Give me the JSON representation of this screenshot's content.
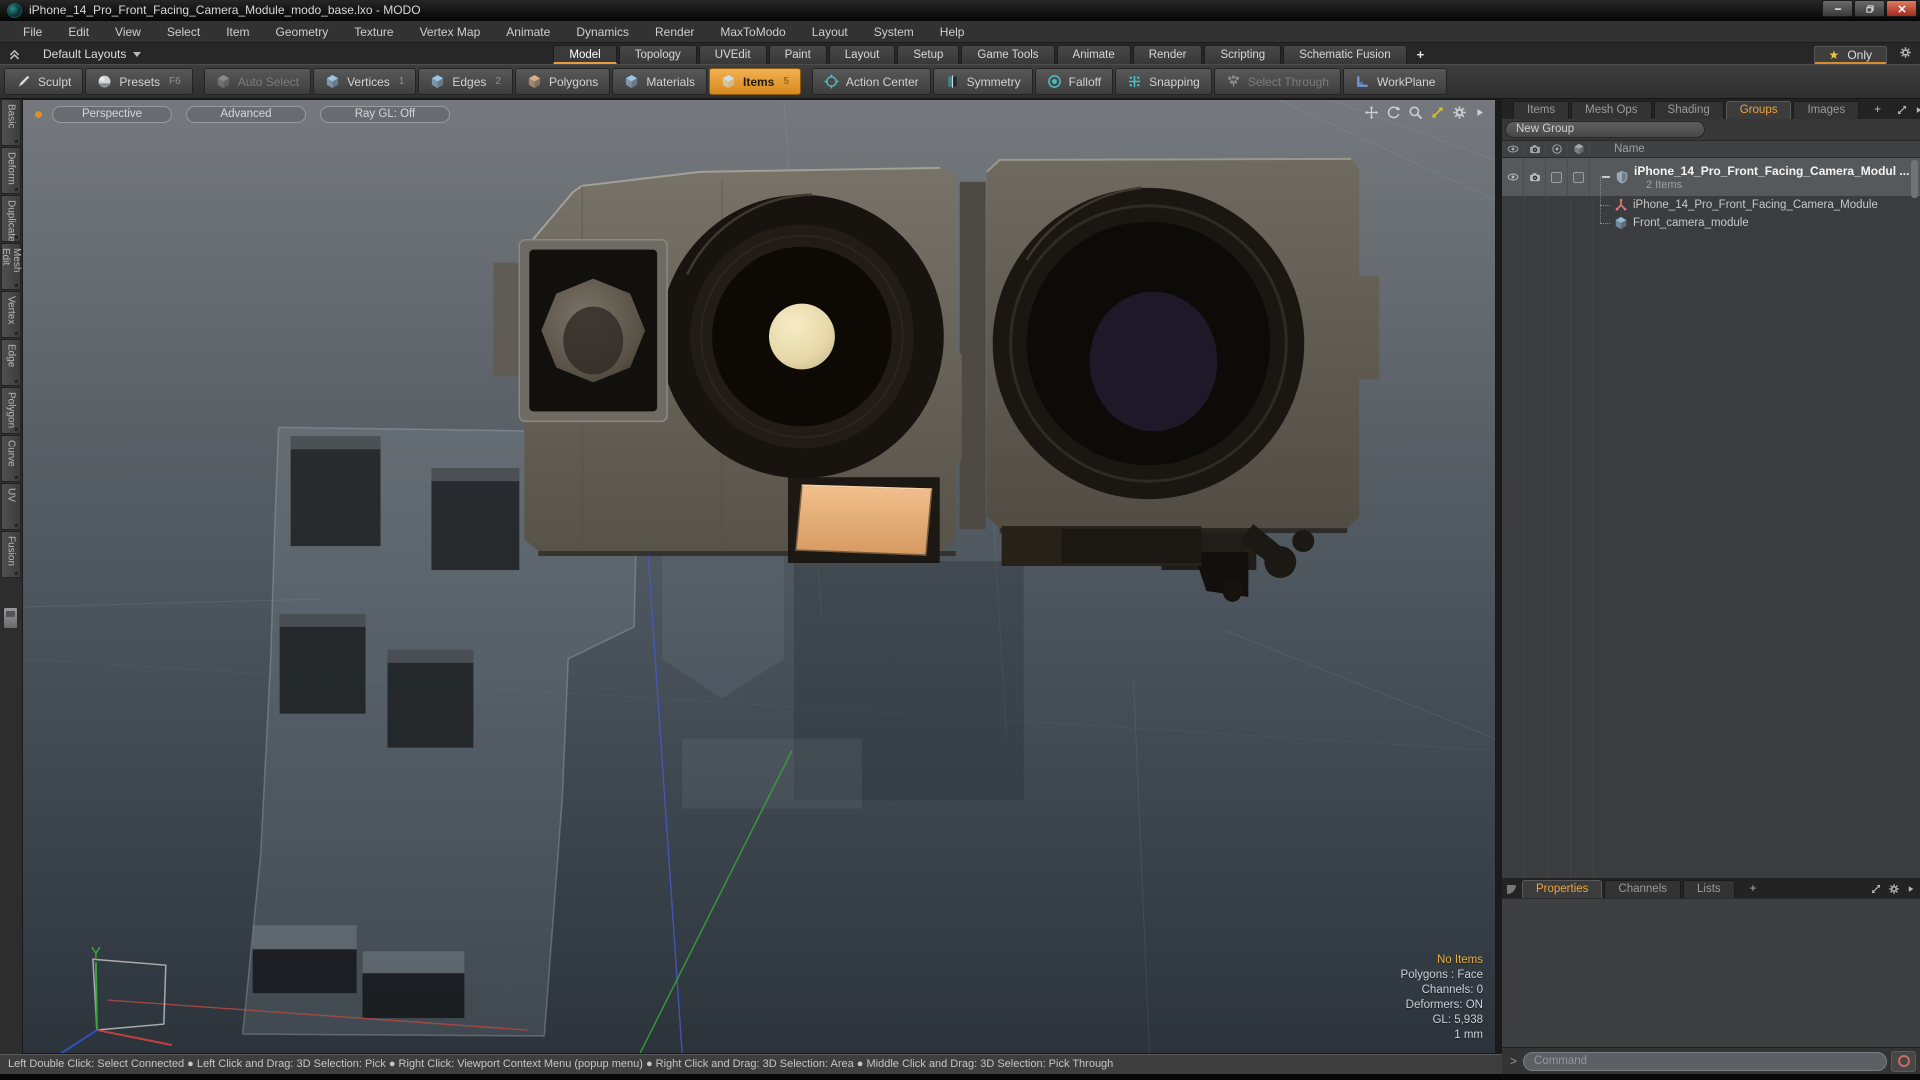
{
  "window": {
    "title": "iPhone_14_Pro_Front_Facing_Camera_Module_modo_base.lxo - MODO"
  },
  "menu": {
    "items": [
      "File",
      "Edit",
      "View",
      "Select",
      "Item",
      "Geometry",
      "Texture",
      "Vertex Map",
      "Animate",
      "Dynamics",
      "Render",
      "MaxToModo",
      "Layout",
      "System",
      "Help"
    ]
  },
  "layout_bar": {
    "layouts_label": "Default Layouts",
    "tabs": [
      "Model",
      "Topology",
      "UVEdit",
      "Paint",
      "Layout",
      "Setup",
      "Game Tools",
      "Animate",
      "Render",
      "Scripting",
      "Schematic Fusion"
    ],
    "add_tab": "+",
    "star": "★",
    "only_label": "Only"
  },
  "toolbar": {
    "sculpt": "Sculpt",
    "presets": "Presets",
    "presets_shortcut": "F6",
    "auto_select": "Auto Select",
    "vertices": "Vertices",
    "vertices_shortcut": "1",
    "edges": "Edges",
    "edges_shortcut": "2",
    "polygons": "Polygons",
    "materials": "Materials",
    "items": "Items",
    "items_shortcut": "5",
    "action_center": "Action Center",
    "symmetry": "Symmetry",
    "falloff": "Falloff",
    "snapping": "Snapping",
    "select_through": "Select Through",
    "workplane": "WorkPlane"
  },
  "left_tabs": {
    "items": [
      "Basic",
      "Deform",
      "Duplicate",
      "Mesh Edit",
      "Vertex",
      "Edge",
      "Polygon",
      "Curve",
      "UV",
      "Fusion"
    ]
  },
  "viewport": {
    "buttons": [
      "Perspective",
      "Advanced",
      "Ray GL: Off"
    ],
    "status": {
      "highlight": "No Items",
      "lines": [
        "Polygons : Face",
        "Channels: 0",
        "Deformers: ON",
        "GL: 5,938",
        "1 mm"
      ]
    }
  },
  "right_panel": {
    "tabs": [
      "Items",
      "Mesh Ops",
      "Shading",
      "Groups",
      "Images"
    ],
    "add_tab": "+",
    "new_group": "New Group",
    "tree_header": "Name",
    "tree": {
      "group_name": "iPhone_14_Pro_Front_Facing_Camera_Modul ...",
      "group_subtitle": "2 Items",
      "child1": "iPhone_14_Pro_Front_Facing_Camera_Module",
      "child2": "Front_camera_module"
    },
    "bottom_tabs": [
      "Properties",
      "Channels",
      "Lists"
    ],
    "bottom_add_tab": "+",
    "command_prompt": ">",
    "command_placeholder": "Command"
  },
  "help_bar": {
    "text": "Left Double Click: Select Connected ● Left Click and Drag: 3D Selection: Pick ● Right Click: Viewport Context Menu (popup menu) ● Right Click and Drag: 3D Selection: Area ● Middle Click and Drag: 3D Selection: Pick Through"
  },
  "colors": {
    "accent_orange": "#e89c3c",
    "teal": "#4cc0c0",
    "selection_yellow": "#e8c83c",
    "status_yellow": "#e8b23c"
  }
}
